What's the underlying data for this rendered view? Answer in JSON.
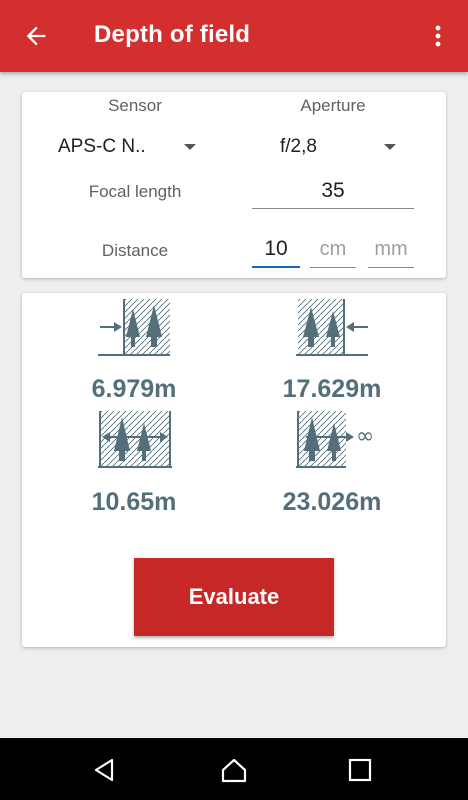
{
  "app_bar": {
    "title": "Depth of field",
    "back_icon": "arrow-back-icon",
    "menu_icon": "more-vert-icon",
    "color": "#d32f2f"
  },
  "settings": {
    "sensor_label": "Sensor",
    "sensor_value": "APS-C N..",
    "aperture_label": "Aperture",
    "aperture_value": "f/2,8",
    "focal_label": "Focal length",
    "focal_value": "35",
    "distance_label": "Distance",
    "distance_m_value": "10",
    "distance_cm_placeholder": "cm",
    "distance_mm_placeholder": "mm"
  },
  "results": {
    "near_limit": "6.979m",
    "far_limit": "17.629m",
    "total_dof": "10.65m",
    "hyperfocal": "23.026m",
    "infinity_symbol": "∞",
    "value_color": "#546e7a"
  },
  "evaluate_label": "Evaluate",
  "nav_bar": {
    "back_icon": "nav-back-icon",
    "home_icon": "nav-home-icon",
    "recents_icon": "nav-recents-icon"
  }
}
